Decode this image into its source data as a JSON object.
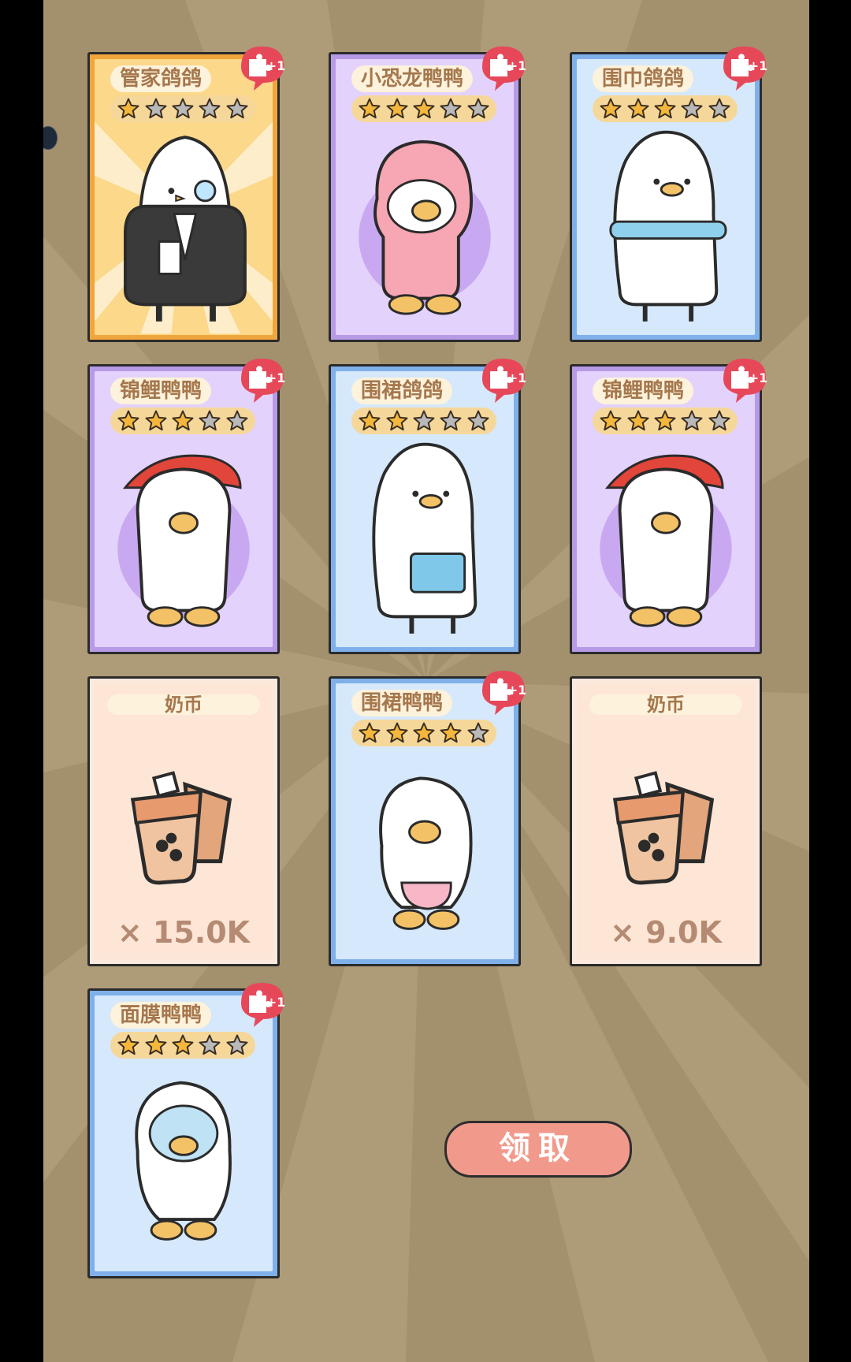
{
  "cards": [
    {
      "name": "管家鸽鸽",
      "stars": 1,
      "type": "character",
      "theme": "gold",
      "badge": "+1"
    },
    {
      "name": "小恐龙鸭鸭",
      "stars": 3,
      "type": "character",
      "theme": "purple",
      "badge": "+1"
    },
    {
      "name": "围巾鸽鸽",
      "stars": 3,
      "type": "character",
      "theme": "blue",
      "badge": "+1"
    },
    {
      "name": "锦鲤鸭鸭",
      "stars": 3,
      "type": "character",
      "theme": "purple",
      "badge": "+1"
    },
    {
      "name": "围裙鸽鸽",
      "stars": 2,
      "type": "character",
      "theme": "blue",
      "badge": "+1"
    },
    {
      "name": "锦鲤鸭鸭",
      "stars": 3,
      "type": "character",
      "theme": "purple",
      "badge": "+1"
    },
    {
      "name": "奶币",
      "type": "currency",
      "amount": "× 15.0K"
    },
    {
      "name": "围裙鸭鸭",
      "stars": 4,
      "type": "character",
      "theme": "blue",
      "badge": "+1"
    },
    {
      "name": "奶币",
      "type": "currency",
      "amount": "× 9.0K"
    },
    {
      "name": "面膜鸭鸭",
      "stars": 3,
      "type": "character",
      "theme": "blue",
      "badge": "+1"
    }
  ],
  "claim_button": "领取",
  "colors": {
    "star_on": "#f4b73c",
    "star_off": "#b9b9b9",
    "badge": "#e6485a",
    "button": "#f19a8c",
    "background": "#a3906c"
  }
}
